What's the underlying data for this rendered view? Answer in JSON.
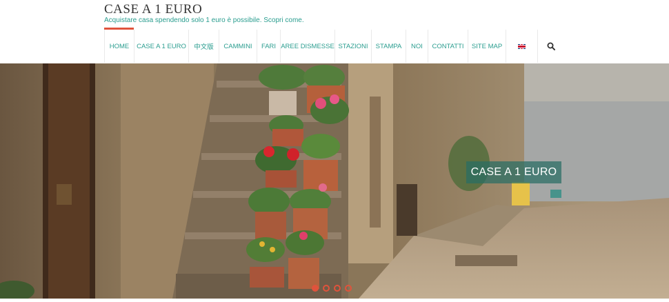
{
  "header": {
    "title": "CASE A 1 EURO",
    "tagline": "Acquistare casa spendendo solo 1 euro è possibile. Scopri come."
  },
  "nav": {
    "items": [
      {
        "label": "HOME",
        "active": true
      },
      {
        "label": "CASE A 1 EURO"
      },
      {
        "label": "中文版"
      },
      {
        "label": "CAMMINI"
      },
      {
        "label": "FARI"
      },
      {
        "label": "AREE DISMESSE"
      },
      {
        "label": "STAZIONI"
      },
      {
        "label": "STAMPA"
      },
      {
        "label": "NOI"
      },
      {
        "label": "CONTATTI"
      },
      {
        "label": "SITE MAP"
      }
    ],
    "language_icon": "uk-flag-icon",
    "search_icon": "search-icon"
  },
  "hero": {
    "caption": "CASE A 1 EURO",
    "slides_count": 4,
    "active_slide": 1
  },
  "colors": {
    "accent": "#2a9d8f",
    "highlight": "#e0533c",
    "caption_bg": "#286e64"
  }
}
